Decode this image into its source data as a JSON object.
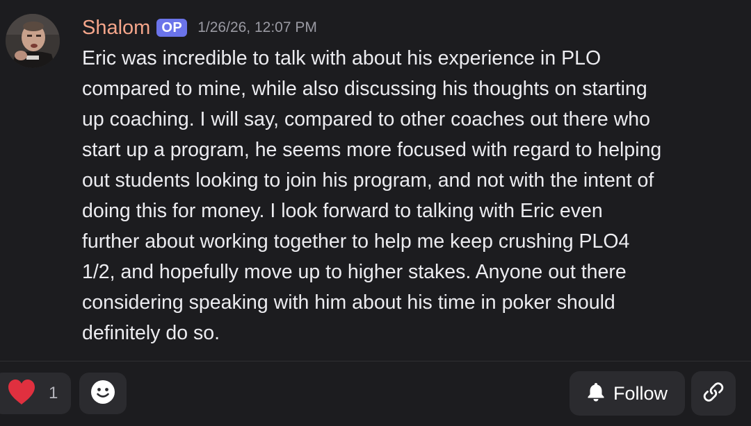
{
  "message": {
    "author": "Shalom",
    "badge": "OP",
    "timestamp": "1/26/26, 12:07 PM",
    "text": "Eric was incredible to talk with about his experience in PLO\ncompared to mine, while also discussing his thoughts on starting\nup coaching. I will say, compared to other coaches out there who\nstart up a program, he seems more focused with regard to helping\nout students looking to join his program, and not with the intent of\ndoing this for money. I look forward to talking with Eric even\nfurther about working together to help me keep crushing PLO4\n1/2, and hopefully move up to higher stakes. Anyone out there\nconsidering speaking with him about his time in poker should\ndefinitely do so."
  },
  "reactions": [
    {
      "icon": "heart-icon",
      "count": "1",
      "color": "#e0303f"
    }
  ],
  "actions": {
    "add_reaction_icon": "smiley-icon",
    "follow_label": "Follow",
    "follow_icon": "bell-icon",
    "copy_link_icon": "link-icon"
  },
  "colors": {
    "background": "#1c1c1f",
    "author": "#f4a58a",
    "badge": "#6b74ea",
    "button": "#2b2b2f"
  }
}
